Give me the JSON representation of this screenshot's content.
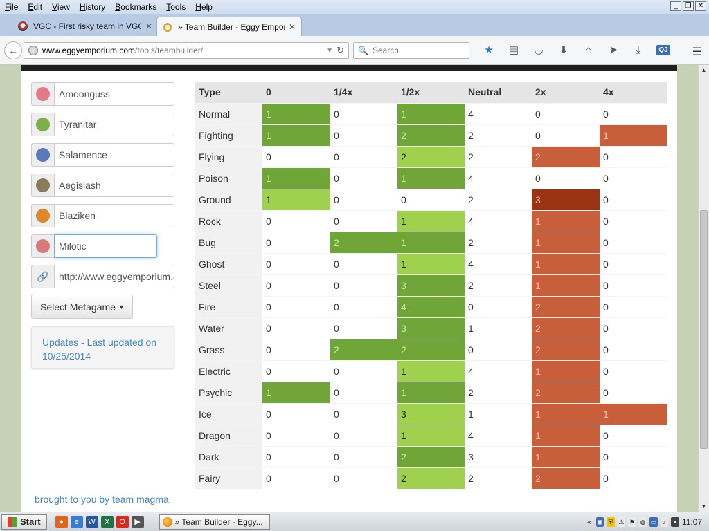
{
  "menu": [
    {
      "key": "F",
      "rest": "ile"
    },
    {
      "key": "E",
      "rest": "dit"
    },
    {
      "key": "V",
      "rest": "iew"
    },
    {
      "key": "H",
      "rest": "istory"
    },
    {
      "key": "B",
      "rest": "ookmarks"
    },
    {
      "key": "T",
      "rest": "ools"
    },
    {
      "key": "H",
      "rest": "elp"
    }
  ],
  "tabs": [
    {
      "title": "VGC - First risky team in VGC ..."
    },
    {
      "title": "» Team Builder - Eggy Emporium"
    }
  ],
  "url": {
    "host": "www.eggyemporium.com",
    "path": "/tools/teambuilder/"
  },
  "search": {
    "placeholder": "Search"
  },
  "team": [
    {
      "name": "Amoonguss",
      "sprite_color": "#e27a88"
    },
    {
      "name": "Tyranitar",
      "sprite_color": "#7fae4a"
    },
    {
      "name": "Salamence",
      "sprite_color": "#5a79b8"
    },
    {
      "name": "Aegislash",
      "sprite_color": "#8a7b5a"
    },
    {
      "name": "Blaziken",
      "sprite_color": "#e0872c"
    },
    {
      "name": "Milotic",
      "sprite_color": "#d87a7a"
    }
  ],
  "share_url": "http://www.eggyemporium.com/tools/teambuilder/",
  "metagame_button": "Select Metagame",
  "updates_text": "Updates - Last updated on 10/25/2014",
  "footer": "brought to you by team magma",
  "table": {
    "headers": [
      "Type",
      "0",
      "1/4x",
      "1/2x",
      "Neutral",
      "2x",
      "4x"
    ],
    "rows": [
      {
        "type": "Normal",
        "cells": [
          "1",
          "0",
          "1",
          "4",
          "0",
          "0"
        ],
        "styles": [
          "g1",
          "",
          "g1",
          "",
          "",
          ""
        ]
      },
      {
        "type": "Fighting",
        "cells": [
          "1",
          "0",
          "2",
          "2",
          "0",
          "1"
        ],
        "styles": [
          "g1",
          "",
          "g1",
          "",
          "",
          "r1"
        ]
      },
      {
        "type": "Flying",
        "cells": [
          "0",
          "0",
          "2",
          "2",
          "2",
          "0"
        ],
        "styles": [
          "",
          "",
          "g2",
          "",
          "r1",
          ""
        ]
      },
      {
        "type": "Poison",
        "cells": [
          "1",
          "0",
          "1",
          "4",
          "0",
          "0"
        ],
        "styles": [
          "g1",
          "",
          "g1",
          "",
          "",
          ""
        ]
      },
      {
        "type": "Ground",
        "cells": [
          "1",
          "0",
          "0",
          "2",
          "3",
          "0"
        ],
        "styles": [
          "g2",
          "",
          "",
          "",
          "r2",
          ""
        ]
      },
      {
        "type": "Rock",
        "cells": [
          "0",
          "0",
          "1",
          "4",
          "1",
          "0"
        ],
        "styles": [
          "",
          "",
          "g2",
          "",
          "r1",
          ""
        ]
      },
      {
        "type": "Bug",
        "cells": [
          "0",
          "2",
          "1",
          "2",
          "1",
          "0"
        ],
        "styles": [
          "",
          "g1",
          "g1",
          "",
          "r1",
          ""
        ]
      },
      {
        "type": "Ghost",
        "cells": [
          "0",
          "0",
          "1",
          "4",
          "1",
          "0"
        ],
        "styles": [
          "",
          "",
          "g2",
          "",
          "r1",
          ""
        ]
      },
      {
        "type": "Steel",
        "cells": [
          "0",
          "0",
          "3",
          "2",
          "1",
          "0"
        ],
        "styles": [
          "",
          "",
          "g1",
          "",
          "r1",
          ""
        ]
      },
      {
        "type": "Fire",
        "cells": [
          "0",
          "0",
          "4",
          "0",
          "2",
          "0"
        ],
        "styles": [
          "",
          "",
          "g1",
          "",
          "r1",
          ""
        ]
      },
      {
        "type": "Water",
        "cells": [
          "0",
          "0",
          "3",
          "1",
          "2",
          "0"
        ],
        "styles": [
          "",
          "",
          "g1",
          "",
          "r1",
          ""
        ]
      },
      {
        "type": "Grass",
        "cells": [
          "0",
          "2",
          "2",
          "0",
          "2",
          "0"
        ],
        "styles": [
          "",
          "g1",
          "g1",
          "",
          "r1",
          ""
        ]
      },
      {
        "type": "Electric",
        "cells": [
          "0",
          "0",
          "1",
          "4",
          "1",
          "0"
        ],
        "styles": [
          "",
          "",
          "g2",
          "",
          "r1",
          ""
        ]
      },
      {
        "type": "Psychic",
        "cells": [
          "1",
          "0",
          "1",
          "2",
          "2",
          "0"
        ],
        "styles": [
          "g1",
          "",
          "g1",
          "",
          "r1",
          ""
        ]
      },
      {
        "type": "Ice",
        "cells": [
          "0",
          "0",
          "3",
          "1",
          "1",
          "1"
        ],
        "styles": [
          "",
          "",
          "g2",
          "",
          "r1",
          "r1"
        ]
      },
      {
        "type": "Dragon",
        "cells": [
          "0",
          "0",
          "1",
          "4",
          "1",
          "0"
        ],
        "styles": [
          "",
          "",
          "g2",
          "",
          "r1",
          ""
        ]
      },
      {
        "type": "Dark",
        "cells": [
          "0",
          "0",
          "2",
          "3",
          "1",
          "0"
        ],
        "styles": [
          "",
          "",
          "g1",
          "",
          "r1",
          ""
        ]
      },
      {
        "type": "Fairy",
        "cells": [
          "0",
          "0",
          "2",
          "2",
          "2",
          "0"
        ],
        "styles": [
          "",
          "",
          "g2",
          "",
          "r1",
          ""
        ]
      }
    ]
  },
  "taskbar": {
    "start": "Start",
    "window": "» Team Builder - Eggy...",
    "clock": "11:07"
  }
}
